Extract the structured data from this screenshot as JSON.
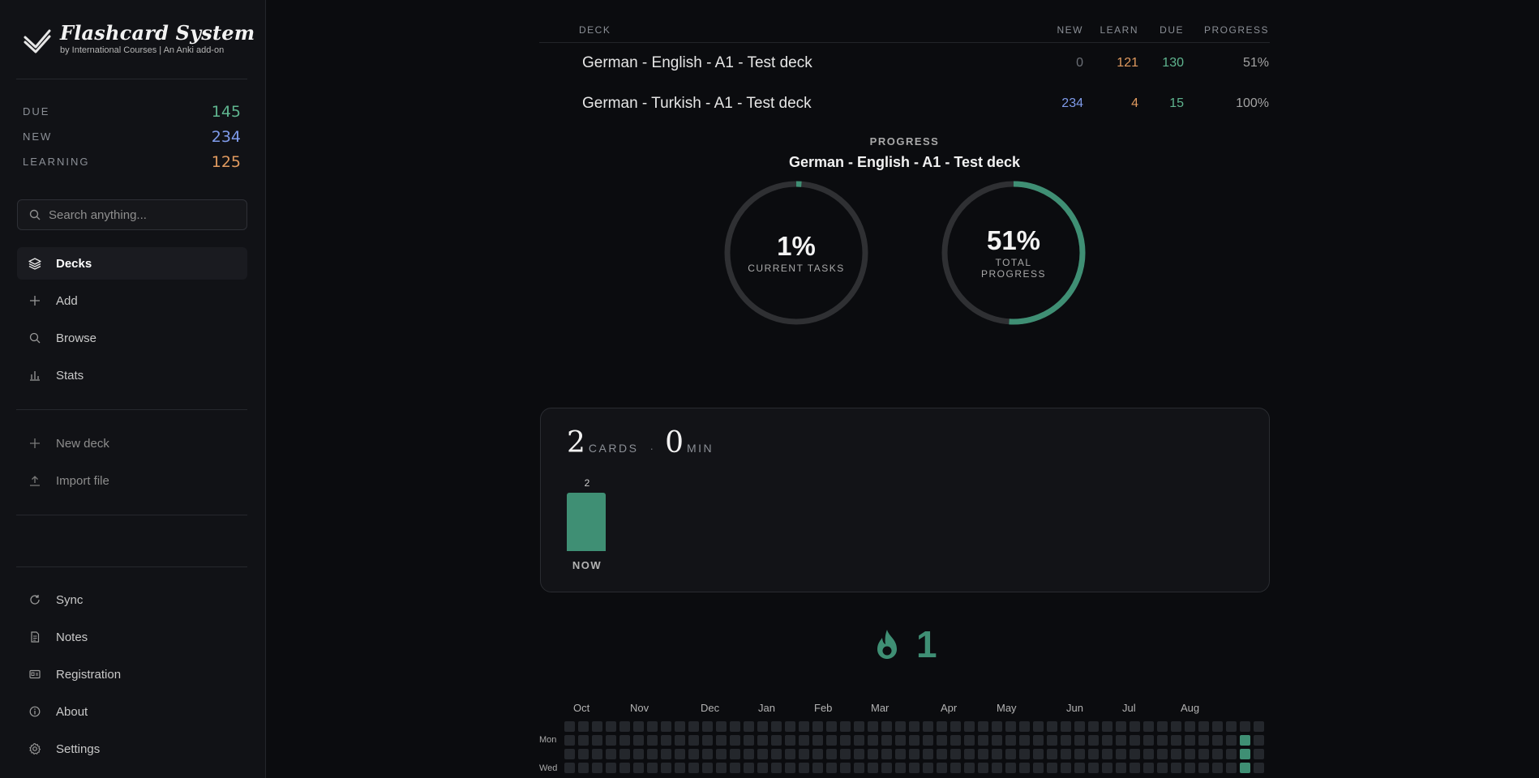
{
  "brand": {
    "title": "Flashcard System",
    "subtitle": "by International Courses | An Anki add-on"
  },
  "sidebar_stats": [
    {
      "label": "DUE",
      "value": "145",
      "color": "#5fb58f"
    },
    {
      "label": "NEW",
      "value": "234",
      "color": "#7f9bea"
    },
    {
      "label": "LEARNING",
      "value": "125",
      "color": "#e09a5f"
    }
  ],
  "search": {
    "placeholder": "Search anything..."
  },
  "nav_main": [
    {
      "label": "Decks",
      "icon": "layers-icon",
      "active": true
    },
    {
      "label": "Add",
      "icon": "plus-icon"
    },
    {
      "label": "Browse",
      "icon": "search-icon"
    },
    {
      "label": "Stats",
      "icon": "bar-chart-icon"
    }
  ],
  "nav_actions": [
    {
      "label": "New deck",
      "icon": "plus-icon"
    },
    {
      "label": "Import file",
      "icon": "upload-icon"
    }
  ],
  "nav_bottom": [
    {
      "label": "Sync",
      "icon": "sync-icon"
    },
    {
      "label": "Notes",
      "icon": "document-icon"
    },
    {
      "label": "Registration",
      "icon": "id-card-icon"
    },
    {
      "label": "About",
      "icon": "info-icon"
    },
    {
      "label": "Settings",
      "icon": "gear-icon"
    }
  ],
  "deck_table": {
    "headers": {
      "deck": "DECK",
      "new": "NEW",
      "learn": "LEARN",
      "due": "DUE",
      "progress": "PROGRESS"
    },
    "rows": [
      {
        "deck": "German - English - A1 - Test deck",
        "new": "0",
        "learn": "121",
        "due": "130",
        "progress": "51%"
      },
      {
        "deck": "German - Turkish - A1 - Test deck",
        "new": "234",
        "learn": "4",
        "due": "15",
        "progress": "100%"
      }
    ]
  },
  "progress": {
    "kicker": "PROGRESS",
    "deck": "German - English - A1 - Test deck",
    "rings": [
      {
        "value": "1%",
        "label": "CURRENT TASKS",
        "fraction": 0.01
      },
      {
        "value": "51%",
        "label": "TOTAL PROGRESS",
        "fraction": 0.51
      }
    ]
  },
  "forecast": {
    "cards": "2",
    "cards_unit": "CARDS",
    "minutes": "0",
    "minutes_unit": "MIN",
    "bars": [
      {
        "label": "NOW",
        "count": "2",
        "value": 2
      }
    ]
  },
  "streak": {
    "value": "1",
    "icon": "flame-icon"
  },
  "heatmap": {
    "months": [
      "Oct",
      "Nov",
      "Dec",
      "Jan",
      "Feb",
      "Mar",
      "Apr",
      "May",
      "Jun",
      "Jul",
      "Aug"
    ],
    "day_labels": [
      "Mon",
      "Wed"
    ],
    "weeks": 51,
    "active_cells": [
      [
        49,
        1
      ],
      [
        49,
        2
      ],
      [
        49,
        3
      ]
    ],
    "color_empty": "#24272c",
    "color_active": "#3f8f74"
  },
  "colors": {
    "accent": "#3f8f74",
    "due": "#5fb58f",
    "new": "#7f9bea",
    "learn": "#e09a5f"
  }
}
